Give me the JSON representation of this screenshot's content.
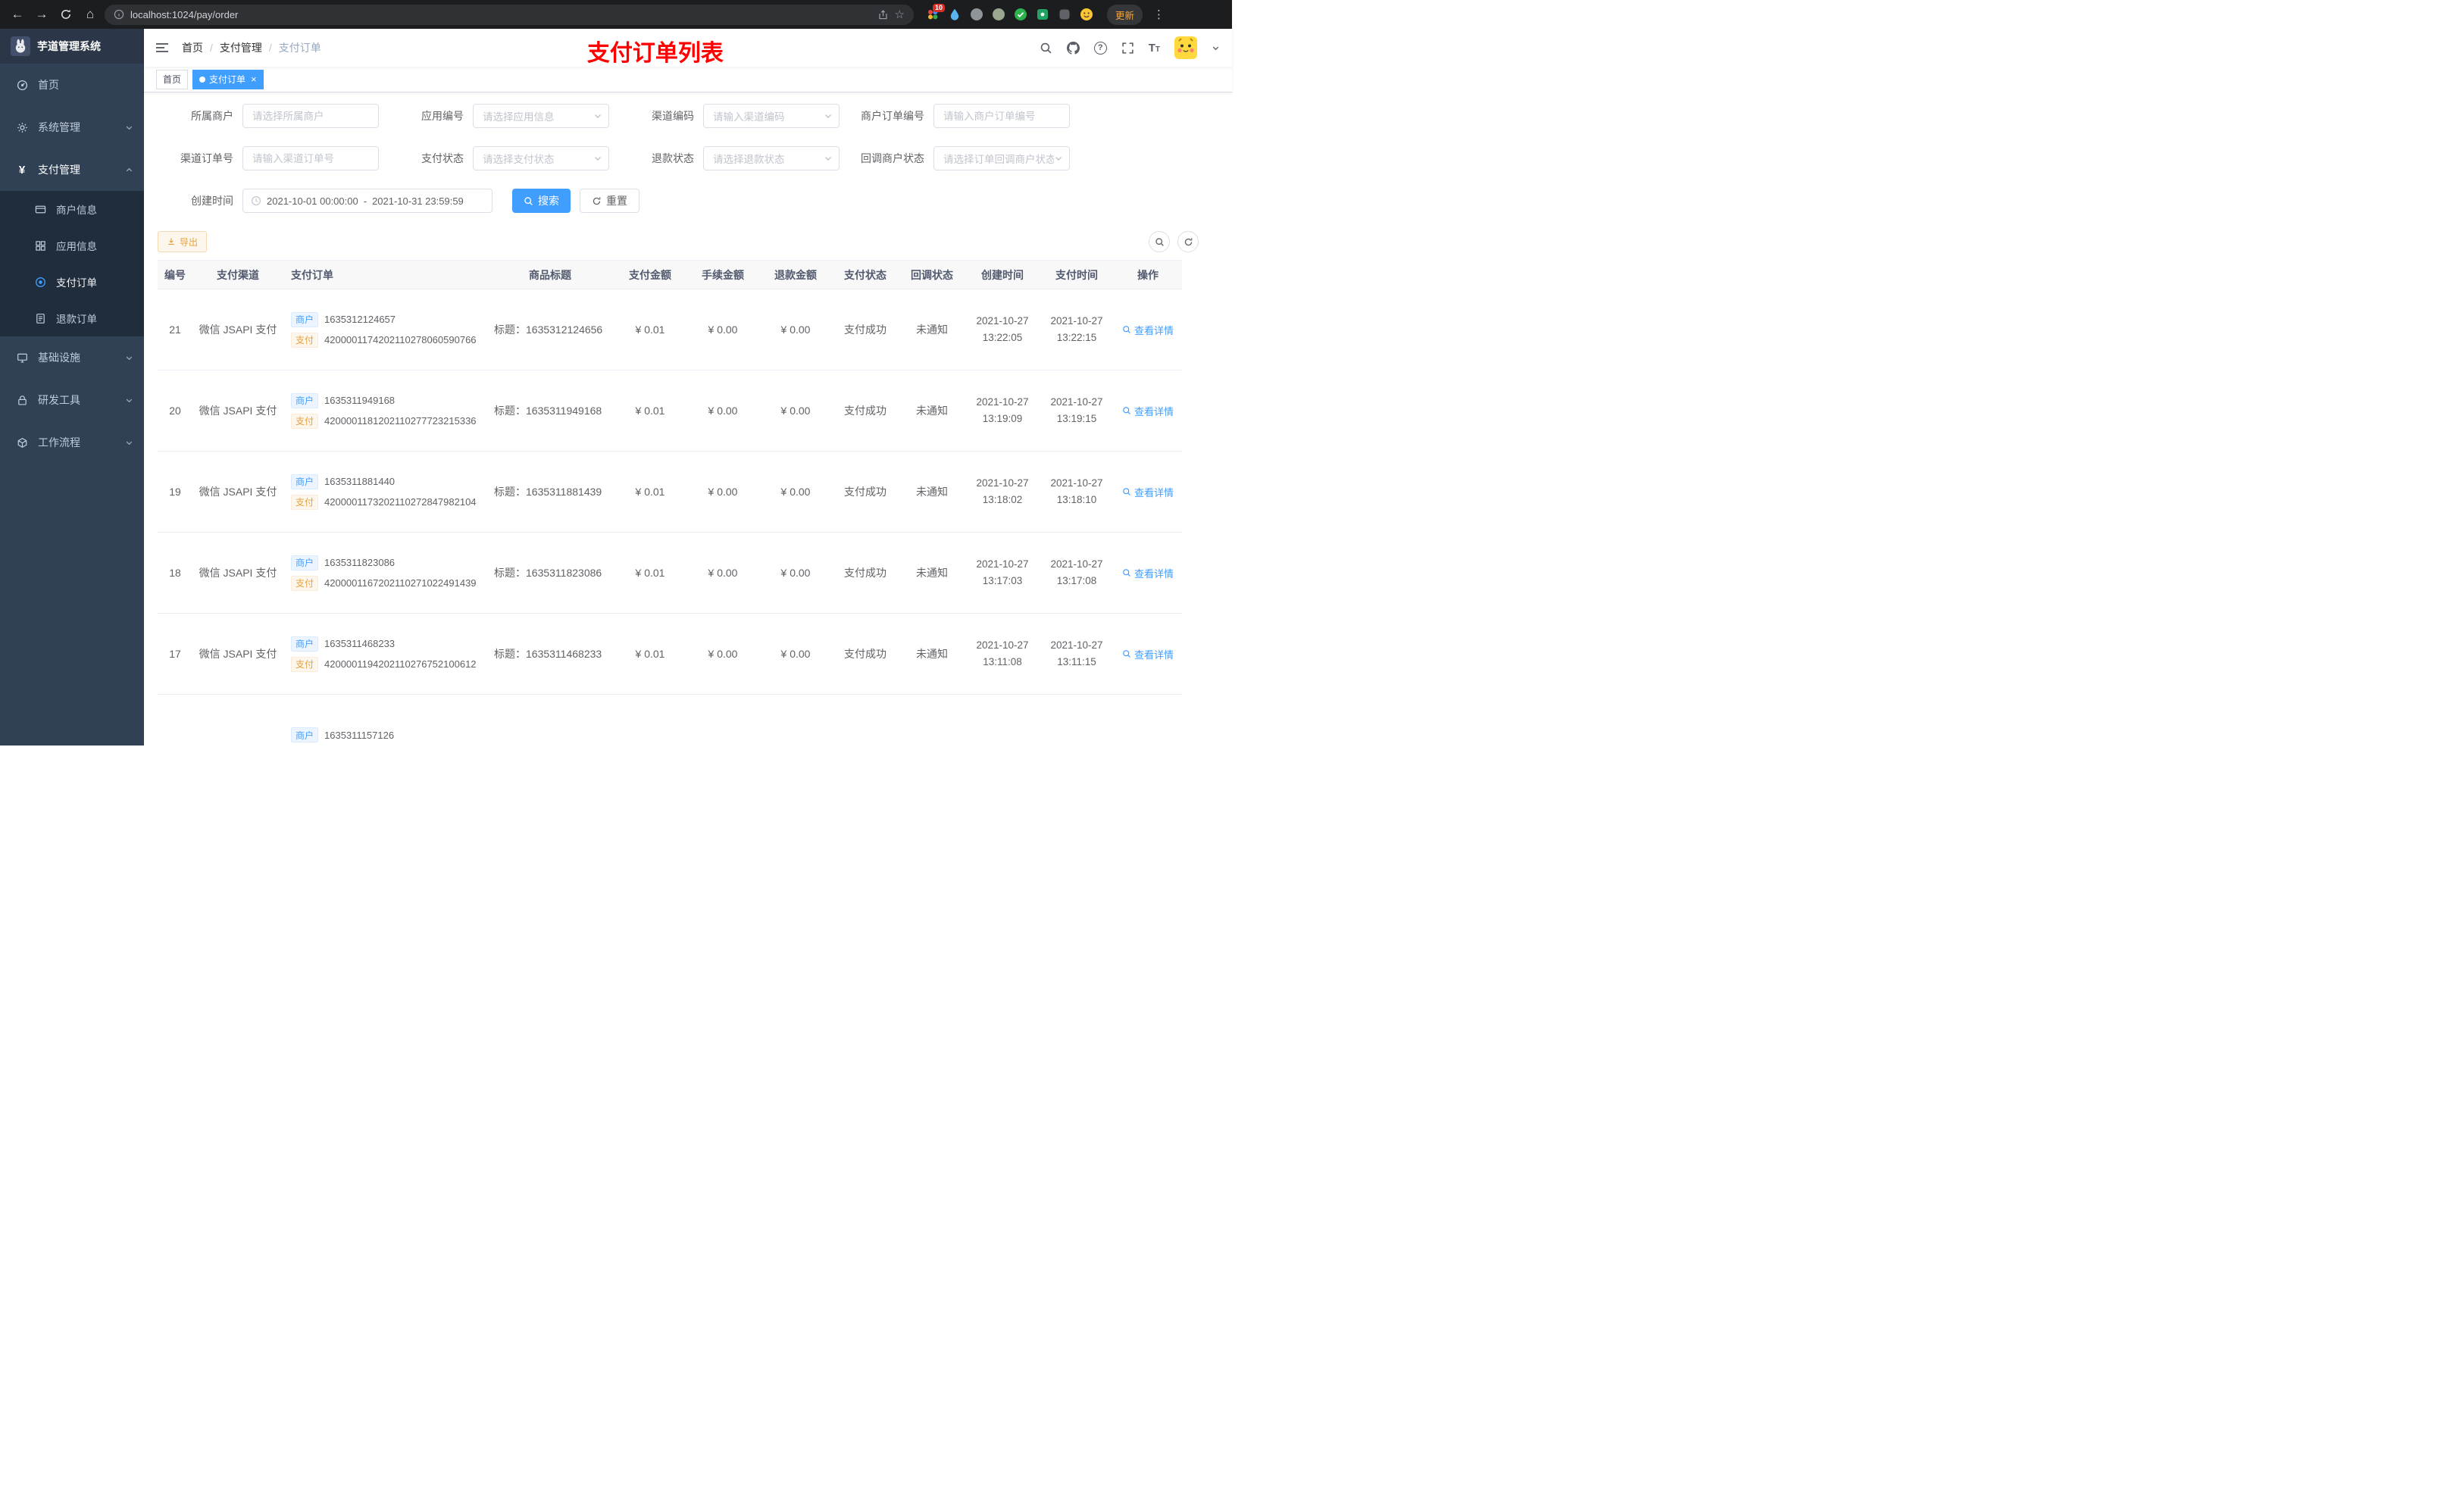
{
  "browser": {
    "url": "localhost:1024/pay/order",
    "update_label": "更新",
    "extension_badge": "10"
  },
  "sidebar": {
    "logo_title": "芋道管理系统",
    "items": [
      {
        "label": "首页",
        "icon": "dashboard"
      },
      {
        "label": "系统管理",
        "icon": "gear",
        "chevron": "down"
      },
      {
        "label": "支付管理",
        "icon": "yen",
        "chevron": "up"
      },
      {
        "label": "商户信息",
        "icon": "bankcard"
      },
      {
        "label": "应用信息",
        "icon": "grid"
      },
      {
        "label": "支付订单",
        "icon": "target"
      },
      {
        "label": "退款订单",
        "icon": "document"
      },
      {
        "label": "基础设施",
        "icon": "monitor",
        "chevron": "down"
      },
      {
        "label": "研发工具",
        "icon": "lock",
        "chevron": "down"
      },
      {
        "label": "工作流程",
        "icon": "cube",
        "chevron": "down"
      }
    ]
  },
  "navbar": {
    "breadcrumb": [
      "首页",
      "支付管理",
      "支付订单"
    ],
    "annotation": "支付订单列表",
    "help_glyph": "?",
    "font_icon_glyph": "T"
  },
  "icons": {
    "yen_glyph": "¥"
  },
  "tabs": [
    {
      "label": "首页",
      "active": false
    },
    {
      "label": "支付订单",
      "active": true
    }
  ],
  "filters": {
    "fields": [
      {
        "label": "所属商户",
        "placeholder": "请选择所属商户",
        "type": "input"
      },
      {
        "label": "应用编号",
        "placeholder": "请选择应用信息",
        "type": "select"
      },
      {
        "label": "渠道编码",
        "placeholder": "请输入渠道编码",
        "type": "select"
      },
      {
        "label": "商户订单编号",
        "placeholder": "请输入商户订单编号",
        "type": "input"
      },
      {
        "label": "渠道订单号",
        "placeholder": "请输入渠道订单号",
        "type": "input"
      },
      {
        "label": "支付状态",
        "placeholder": "请选择支付状态",
        "type": "select"
      },
      {
        "label": "退款状态",
        "placeholder": "请选择退款状态",
        "type": "select"
      },
      {
        "label": "回调商户状态",
        "placeholder": "请选择订单回调商户状态",
        "type": "select"
      }
    ],
    "create_time": {
      "label": "创建时间",
      "start": "2021-10-01 00:00:00",
      "separator": "-",
      "end": "2021-10-31 23:59:59"
    },
    "search_label": "搜索",
    "reset_label": "重置"
  },
  "toolbar": {
    "export_label": "导出"
  },
  "table": {
    "columns": [
      "编号",
      "支付渠道",
      "支付订单",
      "商品标题",
      "支付金额",
      "手续金额",
      "退款金额",
      "支付状态",
      "回调状态",
      "创建时间",
      "支付时间",
      "操作"
    ],
    "tag_merchant": "商户",
    "tag_pay": "支付",
    "title_prefix": "标题：",
    "action_label": "查看详情",
    "rows": [
      {
        "id": "21",
        "channel": "微信 JSAPI 支付",
        "merchant_no": "1635312124657",
        "pay_no": "4200001174202110278060590766",
        "title": "1635312124656",
        "amount": "¥ 0.01",
        "fee": "¥ 0.00",
        "refund": "¥ 0.00",
        "pay_status": "支付成功",
        "notify_status": "未通知",
        "create_date": "2021-10-27",
        "create_time": "13:22:05",
        "pay_date": "2021-10-27",
        "pay_time": "13:22:15",
        "has_action": true
      },
      {
        "id": "20",
        "channel": "微信 JSAPI 支付",
        "merchant_no": "1635311949168",
        "pay_no": "4200001181202110277723215336",
        "title": "1635311949168",
        "amount": "¥ 0.01",
        "fee": "¥ 0.00",
        "refund": "¥ 0.00",
        "pay_status": "支付成功",
        "notify_status": "未通知",
        "create_date": "2021-10-27",
        "create_time": "13:19:09",
        "pay_date": "2021-10-27",
        "pay_time": "13:19:15",
        "has_action": true
      },
      {
        "id": "19",
        "channel": "微信 JSAPI 支付",
        "merchant_no": "1635311881440",
        "pay_no": "4200001173202110272847982104",
        "title": "1635311881439",
        "amount": "¥ 0.01",
        "fee": "¥ 0.00",
        "refund": "¥ 0.00",
        "pay_status": "支付成功",
        "notify_status": "未通知",
        "create_date": "2021-10-27",
        "create_time": "13:18:02",
        "pay_date": "2021-10-27",
        "pay_time": "13:18:10",
        "has_action": true
      },
      {
        "id": "18",
        "channel": "微信 JSAPI 支付",
        "merchant_no": "1635311823086",
        "pay_no": "4200001167202110271022491439",
        "title": "1635311823086",
        "amount": "¥ 0.01",
        "fee": "¥ 0.00",
        "refund": "¥ 0.00",
        "pay_status": "支付成功",
        "notify_status": "未通知",
        "create_date": "2021-10-27",
        "create_time": "13:17:03",
        "pay_date": "2021-10-27",
        "pay_time": "13:17:08",
        "has_action": true
      },
      {
        "id": "17",
        "channel": "微信 JSAPI 支付",
        "merchant_no": "1635311468233",
        "pay_no": "4200001194202110276752100612",
        "title": "1635311468233",
        "amount": "¥ 0.01",
        "fee": "¥ 0.00",
        "refund": "¥ 0.00",
        "pay_status": "支付成功",
        "notify_status": "未通知",
        "create_date": "2021-10-27",
        "create_time": "13:11:08",
        "pay_date": "2021-10-27",
        "pay_time": "13:11:15",
        "has_action": true
      },
      {
        "id": "",
        "channel": "",
        "merchant_no": "1635311157126",
        "pay_no": "",
        "title": "",
        "amount": "",
        "fee": "",
        "refund": "",
        "pay_status": "",
        "notify_status": "",
        "create_date": "",
        "create_time": "",
        "pay_date": "",
        "pay_time": "",
        "has_action": false
      }
    ]
  },
  "colors": {
    "accent": "#409eff",
    "warning": "#e6a23c",
    "annotation_red": "#ff0000",
    "sidebar_bg": "#304156",
    "submenu_bg": "#1f2d3d"
  }
}
